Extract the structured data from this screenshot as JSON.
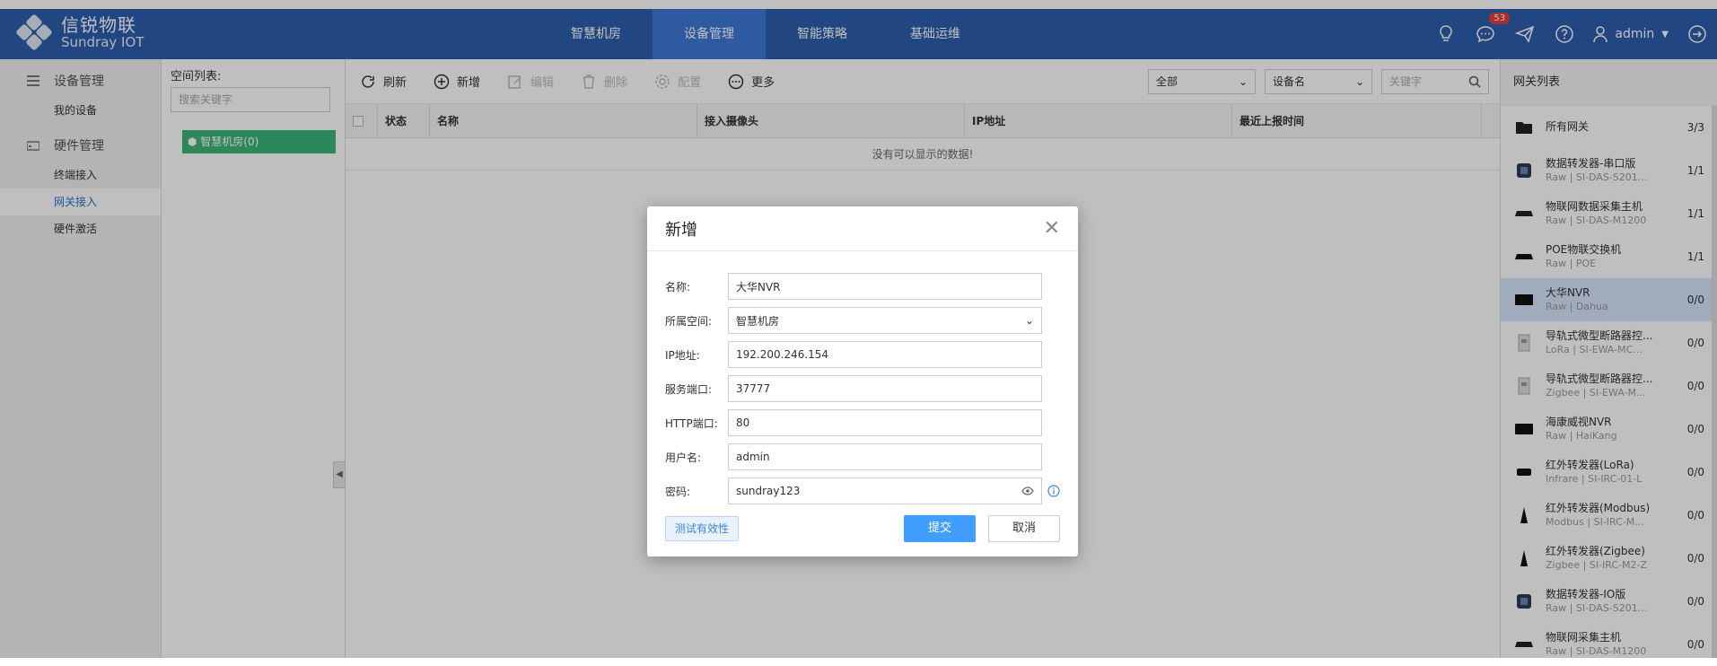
{
  "app": {
    "logo_cn": "信锐物联",
    "logo_en": "Sundray IOT",
    "nav": [
      "智慧机房",
      "设备管理",
      "智能策略",
      "基础运维"
    ],
    "active_nav": 1,
    "message_badge": "53",
    "user": "admin"
  },
  "sidebar": {
    "group1": "设备管理",
    "group1_items": [
      "我的设备"
    ],
    "group2": "硬件管理",
    "group2_items": [
      "终端接入",
      "网关接入",
      "硬件激活"
    ],
    "active_item": "网关接入"
  },
  "space": {
    "title": "空间列表:",
    "search_placeholder": "搜索关键字",
    "node": "智慧机房(0)"
  },
  "toolbar": {
    "refresh": "刷新",
    "add": "新增",
    "edit": "编辑",
    "delete": "删除",
    "config": "配置",
    "more": "更多",
    "filter_all": "全部",
    "filter_field": "设备名",
    "keyword_placeholder": "关键字"
  },
  "table": {
    "columns": [
      "状态",
      "名称",
      "接入摄像头",
      "IP地址",
      "最近上报时间"
    ],
    "empty": "没有可以显示的数据!"
  },
  "gateway": {
    "title": "网关列表",
    "items": [
      {
        "name": "所有网关",
        "sub": "",
        "count": "3/3",
        "icon": "folder-icon"
      },
      {
        "name": "数据转发器-串口版",
        "sub": "Raw | SI-DAS-S201...",
        "count": "1/1",
        "icon": "device-icon"
      },
      {
        "name": "物联网数据采集主机",
        "sub": "Raw | SI-DAS-M1200",
        "count": "1/1",
        "icon": "host-icon"
      },
      {
        "name": "POE物联交换机",
        "sub": "Raw | POE",
        "count": "1/1",
        "icon": "switch-icon"
      },
      {
        "name": "大华NVR",
        "sub": "Raw | Dahua",
        "count": "0/0",
        "icon": "nvr-icon"
      },
      {
        "name": "导轨式微型断路器控...",
        "sub": "LoRa | SI-EWA-MC...",
        "count": "0/0",
        "icon": "breaker-icon"
      },
      {
        "name": "导轨式微型断路器控...",
        "sub": "Zigbee | SI-EWA-M...",
        "count": "0/0",
        "icon": "breaker-icon"
      },
      {
        "name": "海康威视NVR",
        "sub": "Raw | HaiKang",
        "count": "0/0",
        "icon": "nvr-icon"
      },
      {
        "name": "红外转发器(LoRa)",
        "sub": "Infrare | SI-IRC-01-L",
        "count": "0/0",
        "icon": "ir-icon"
      },
      {
        "name": "红外转发器(Modbus)",
        "sub": "Modbus | SI-IRC-M...",
        "count": "0/0",
        "icon": "ir-tower-icon"
      },
      {
        "name": "红外转发器(Zigbee)",
        "sub": "Zigbee | SI-IRC-M2-Z",
        "count": "0/0",
        "icon": "ir-tower-icon"
      },
      {
        "name": "数据转发器-IO版",
        "sub": "Raw | SI-DAS-S201...",
        "count": "0/0",
        "icon": "device-icon"
      },
      {
        "name": "物联网采集主机",
        "sub": "Raw | SI-DAS-M1200",
        "count": "0/0",
        "icon": "host-icon"
      }
    ],
    "active_index": 4
  },
  "modal": {
    "title": "新增",
    "fields": [
      {
        "label": "名称:",
        "value": "大华NVR"
      },
      {
        "label": "所属空间:",
        "value": "智慧机房"
      },
      {
        "label": "IP地址:",
        "value": "192.200.246.154"
      },
      {
        "label": "服务端口:",
        "value": "37777"
      },
      {
        "label": "HTTP端口:",
        "value": "80"
      },
      {
        "label": "用户名:",
        "value": "admin"
      },
      {
        "label": "密码:",
        "value": "sundray123"
      }
    ],
    "test_button": "测试有效性",
    "submit": "提交",
    "cancel": "取消"
  },
  "colors": {
    "header": "#2e5ead",
    "nav_active": "#3d79d6",
    "accent": "#409eff",
    "space_node": "#3cb57c"
  }
}
